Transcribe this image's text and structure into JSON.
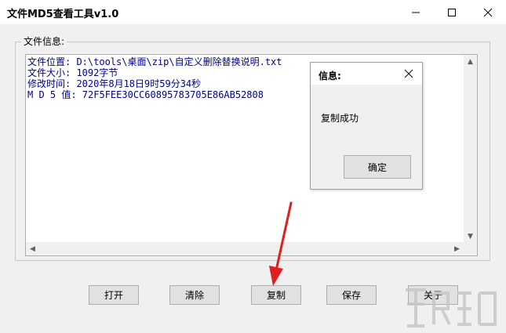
{
  "window": {
    "title": "文件MD5查看工具v1.0"
  },
  "group": {
    "legend": "文件信息:"
  },
  "info_lines": [
    "文件位置: D:\\tools\\桌面\\zip\\自定义删除替换说明.txt",
    "文件大小: 1092字节",
    "修改时间: 2020年8月18日9时59分34秒",
    "M D 5 值: 72F5FEE30CC60895783705E86AB52808"
  ],
  "dialog": {
    "title": "信息:",
    "message": "复制成功",
    "ok_label": "确定"
  },
  "buttons": {
    "open": "打开",
    "clear": "清除",
    "copy": "复制",
    "save": "保存",
    "about": "关于"
  },
  "colors": {
    "text_blue": "#00008b",
    "arrow_red": "#e02020"
  }
}
